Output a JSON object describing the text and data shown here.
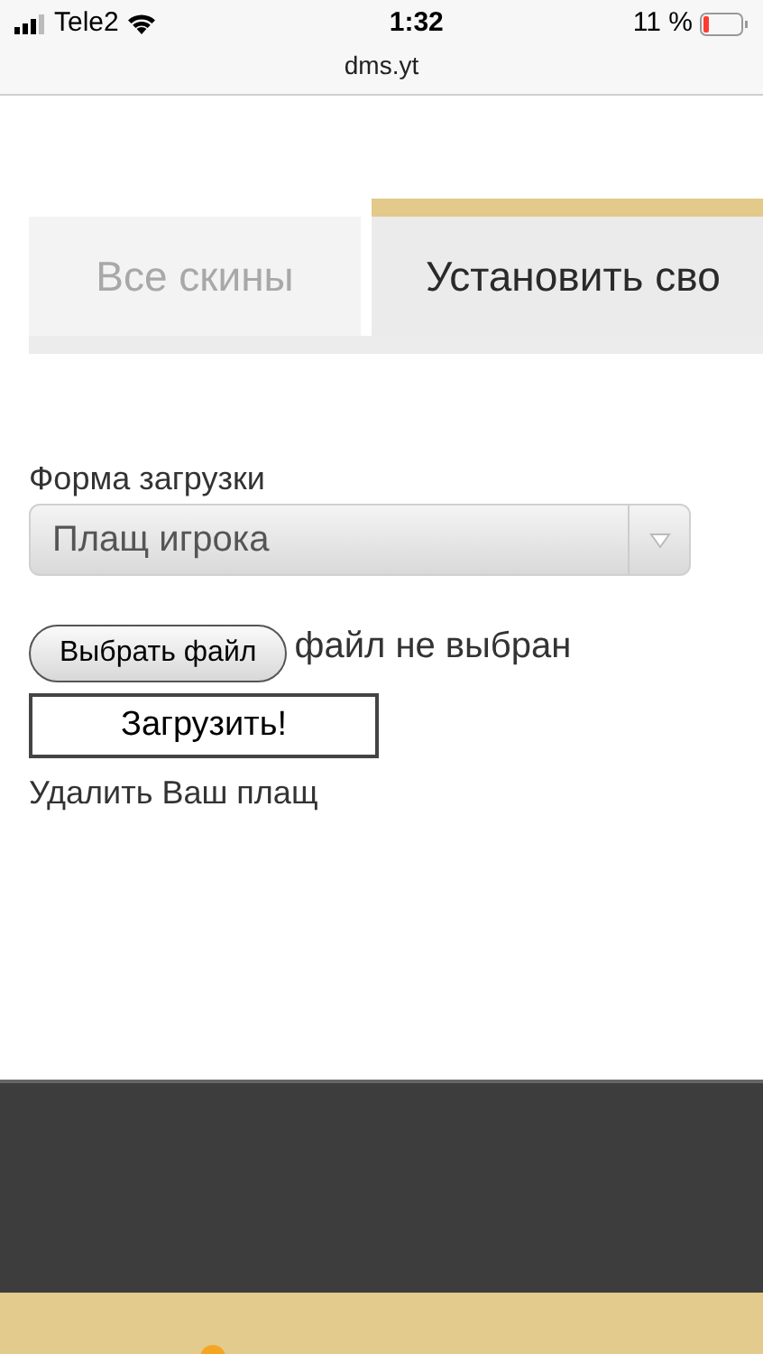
{
  "status_bar": {
    "carrier": "Tele2",
    "time": "1:32",
    "battery": "11 %"
  },
  "address_bar": {
    "url": "dms.yt"
  },
  "tabs": [
    {
      "label": "Все скины",
      "selected": false
    },
    {
      "label": "Установить сво",
      "selected": true
    }
  ],
  "form": {
    "label": "Форма загрузки",
    "select_value": "Плащ игрока",
    "file_button": "Выбрать файл",
    "file_status": "файл не выбран",
    "submit": "Загрузить!",
    "delete_link": "Удалить Ваш плащ"
  }
}
